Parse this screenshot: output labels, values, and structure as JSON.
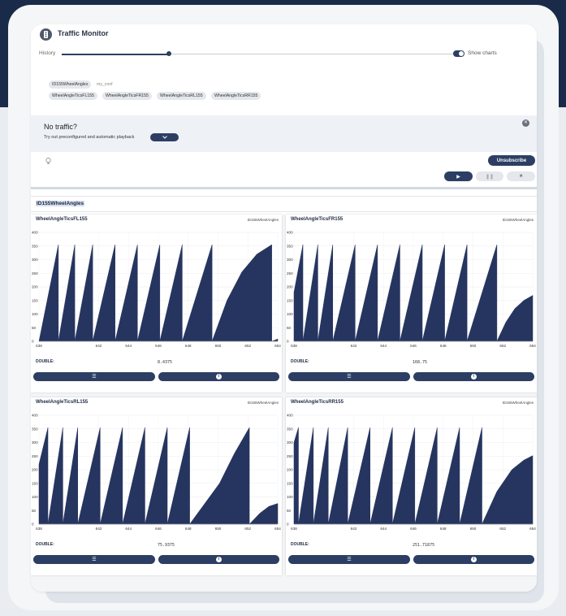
{
  "app": {
    "title": "Traffic Monitor",
    "history_label": "History",
    "history_level": 0.27,
    "show_charts_label": "Show charts",
    "show_charts_on": true
  },
  "tags": {
    "message": "ID155WheelAngles",
    "config": "my_conf",
    "signals": [
      "WheelAngleTicsFL155",
      "WheelAngleTicsFR155",
      "WheelAngleTicsRL155",
      "WheelAngleTicsRR155"
    ]
  },
  "notice": {
    "title": "No traffic?",
    "subtitle": "Try out preconfigured and automatic playback"
  },
  "controls": {
    "unsubscribe_label": "Unsubscribe"
  },
  "group": {
    "title": "ID155WheelAngles"
  },
  "colors": {
    "accent": "#2c3e63",
    "chart_fill": "#26355f"
  },
  "chart_data": [
    {
      "type": "area",
      "title": "WheelAngleTicsFL155",
      "subtitle": "ID155WheelAngles",
      "value_type": "DOUBLE:",
      "value": "8.4375",
      "ylim": [
        0,
        400
      ],
      "yticks": [
        0,
        50,
        100,
        150,
        200,
        250,
        300,
        350,
        400
      ],
      "xlim": [
        638,
        654
      ],
      "xticks": [
        "638",
        "642",
        "644",
        "646",
        "648",
        "650",
        "652",
        "654"
      ],
      "xtick_values": [
        638,
        642,
        644,
        646,
        648,
        650,
        652,
        654
      ],
      "x": [
        638,
        639.3,
        639.3,
        640.4,
        640.4,
        641.6,
        641.6,
        643.1,
        643.1,
        644.6,
        644.6,
        646.1,
        646.1,
        647.6,
        647.6,
        649.6,
        649.6,
        650.6,
        651.6,
        652.6,
        653.6,
        653.6,
        654
      ],
      "y": [
        0,
        355,
        0,
        355,
        0,
        355,
        0,
        355,
        0,
        355,
        0,
        355,
        0,
        355,
        0,
        355,
        0,
        150,
        255,
        320,
        355,
        0,
        8.4375
      ]
    },
    {
      "type": "area",
      "title": "WheelAngleTicsFR155",
      "subtitle": "ID155WheelAngles",
      "value_type": "DOUBLE:",
      "value": "168.75",
      "ylim": [
        0,
        400
      ],
      "yticks": [
        0,
        50,
        100,
        150,
        200,
        250,
        300,
        350,
        400
      ],
      "xlim": [
        638,
        654
      ],
      "xticks": [
        "638",
        "642",
        "644",
        "646",
        "648",
        "650",
        "652",
        "654"
      ],
      "xtick_values": [
        638,
        642,
        644,
        646,
        648,
        650,
        652,
        654
      ],
      "x": [
        638,
        638.6,
        638.6,
        639.6,
        639.6,
        640.6,
        640.6,
        642.1,
        642.1,
        643.6,
        643.6,
        645.1,
        645.1,
        646.6,
        646.6,
        648.1,
        648.1,
        649.6,
        649.6,
        651.6,
        651.6,
        652.2,
        652.8,
        653.4,
        654
      ],
      "y": [
        180,
        355,
        0,
        355,
        0,
        355,
        0,
        355,
        0,
        355,
        0,
        355,
        0,
        355,
        0,
        355,
        0,
        355,
        0,
        355,
        0,
        70,
        120,
        150,
        168.75
      ]
    },
    {
      "type": "area",
      "title": "WheelAngleTicsRL155",
      "subtitle": "ID155WheelAngles",
      "value_type": "DOUBLE:",
      "value": "75.9375",
      "ylim": [
        0,
        400
      ],
      "yticks": [
        0,
        50,
        100,
        150,
        200,
        250,
        300,
        350,
        400
      ],
      "xlim": [
        638,
        654
      ],
      "xticks": [
        "638",
        "642",
        "644",
        "646",
        "648",
        "650",
        "652",
        "654"
      ],
      "xtick_values": [
        638,
        642,
        644,
        646,
        648,
        650,
        652,
        654
      ],
      "x": [
        638,
        638.6,
        638.6,
        639.6,
        639.6,
        640.6,
        640.6,
        642.1,
        642.1,
        643.6,
        643.6,
        645.1,
        645.1,
        646.6,
        646.6,
        648.1,
        648.1,
        650.1,
        651.1,
        652.1,
        652.1,
        652.8,
        653.4,
        654
      ],
      "y": [
        220,
        355,
        0,
        355,
        0,
        355,
        0,
        355,
        0,
        355,
        0,
        355,
        0,
        355,
        0,
        355,
        0,
        150,
        260,
        355,
        0,
        40,
        65,
        75.9375
      ]
    },
    {
      "type": "area",
      "title": "WheelAngleTicsRR155",
      "subtitle": "ID155WheelAngles",
      "value_type": "DOUBLE:",
      "value": "251.71875",
      "ylim": [
        0,
        400
      ],
      "yticks": [
        0,
        50,
        100,
        150,
        200,
        250,
        300,
        350,
        400
      ],
      "xlim": [
        638,
        654
      ],
      "xticks": [
        "638",
        "642",
        "644",
        "646",
        "648",
        "650",
        "652",
        "654"
      ],
      "xtick_values": [
        638,
        642,
        644,
        646,
        648,
        650,
        652,
        654
      ],
      "x": [
        638,
        638.3,
        638.3,
        639.3,
        639.3,
        640.3,
        640.3,
        641.6,
        641.6,
        643.1,
        643.1,
        644.6,
        644.6,
        646.1,
        646.1,
        647.6,
        647.6,
        649.1,
        649.1,
        650.6,
        650.6,
        651.6,
        652.6,
        653.4,
        654
      ],
      "y": [
        300,
        355,
        0,
        355,
        0,
        355,
        0,
        355,
        0,
        355,
        0,
        355,
        0,
        355,
        0,
        355,
        0,
        355,
        0,
        355,
        0,
        120,
        200,
        235,
        251.71875
      ]
    }
  ]
}
